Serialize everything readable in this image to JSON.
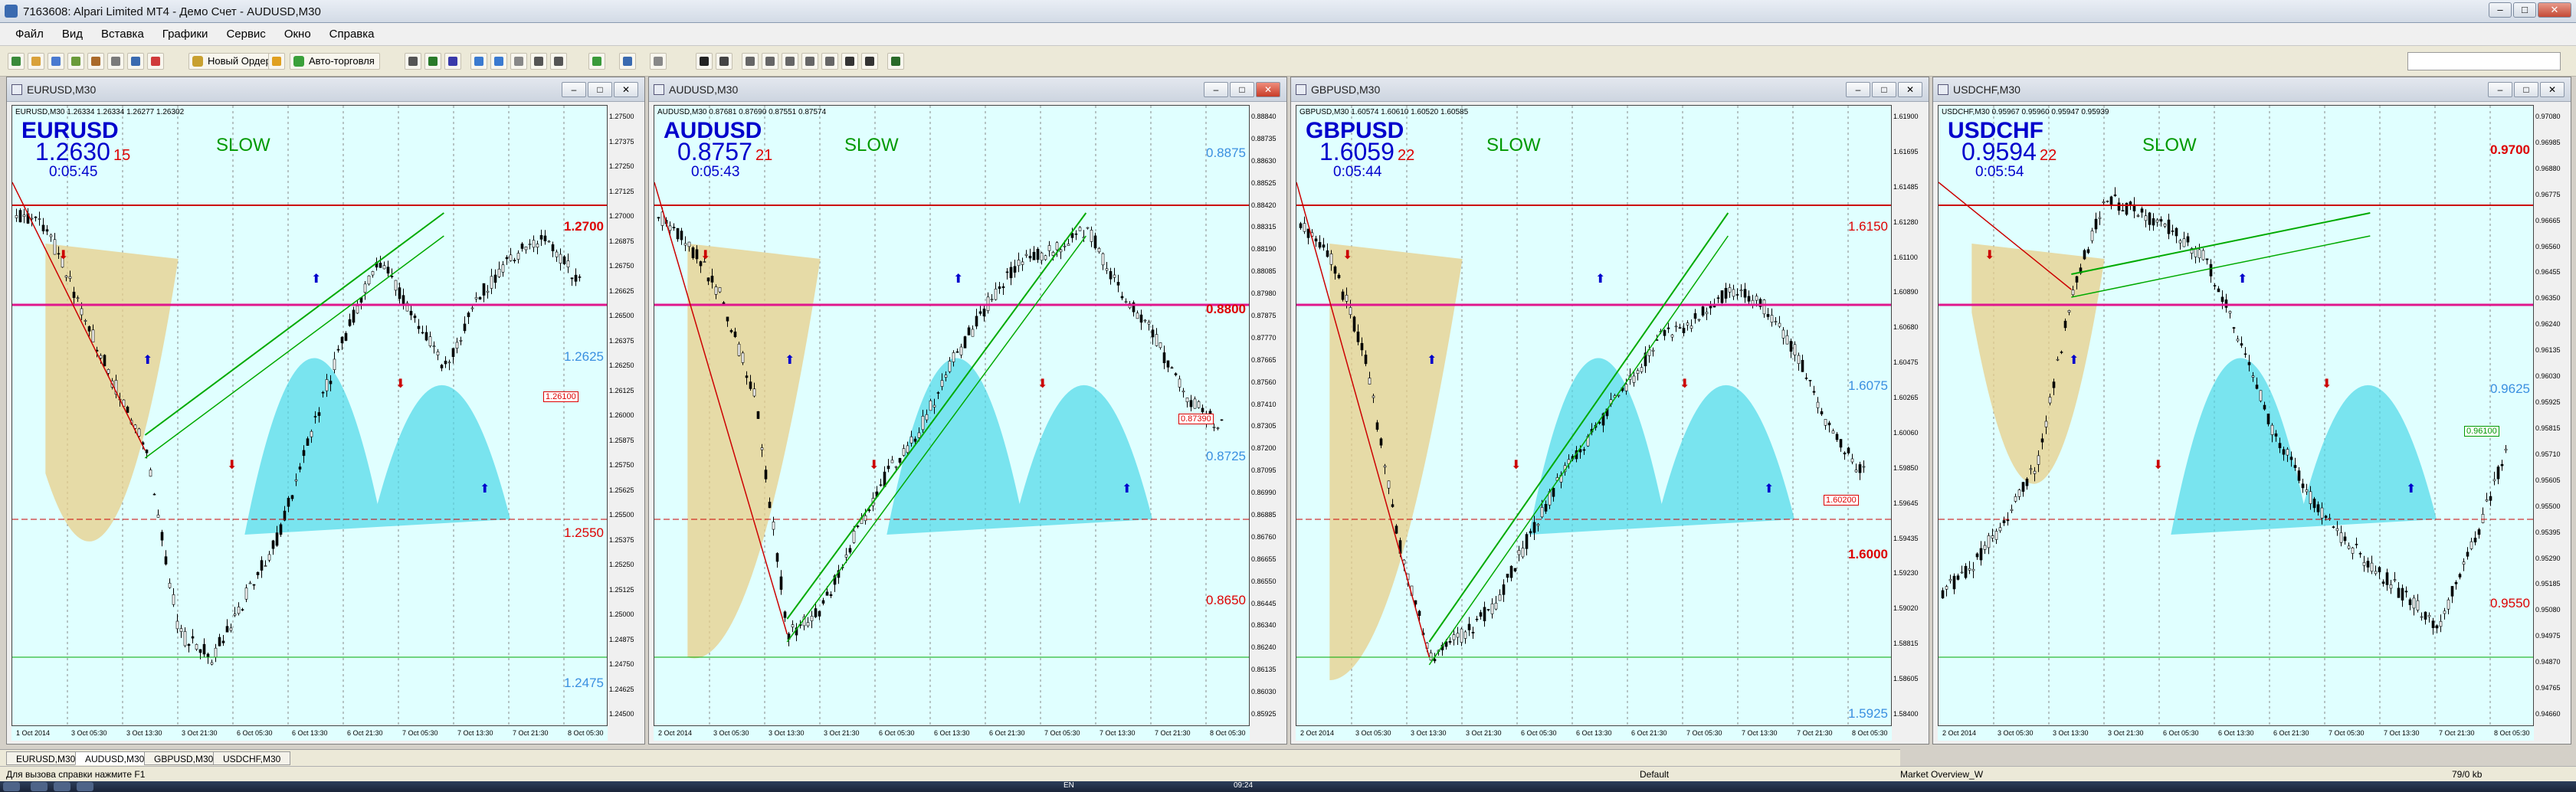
{
  "window": {
    "title": "7163608: Alpari Limited MT4 - Демо Счет - AUDUSD,M30"
  },
  "menu": [
    "Файл",
    "Вид",
    "Вставка",
    "Графики",
    "Сервис",
    "Окно",
    "Справка"
  ],
  "toolbar": {
    "new_order": "Новый Ордер",
    "autotrading": "Авто-торговля"
  },
  "colors": {
    "bg": "#E0FFFF",
    "bull": "#00AA00",
    "bear": "#CC0000",
    "cyan_fill": "#4DD9E8",
    "tan_fill": "#E8CF8A",
    "magenta": "#E0168C",
    "blue": "#0000CC",
    "green": "#009900"
  },
  "charts": [
    {
      "name": "EURUSD,M30",
      "info": "EURUSD,M30 1.26334 1.26334 1.26277 1.26302",
      "symbol": "EURUSD",
      "price": "1.2630",
      "spread": "15",
      "timer": "0:05:45",
      "mode": "SLOW",
      "yticks": [
        "1.27500",
        "1.27375",
        "1.27250",
        "1.27125",
        "1.27000",
        "1.26875",
        "1.26750",
        "1.26625",
        "1.26500",
        "1.26375",
        "1.26250",
        "1.26125",
        "1.26000",
        "1.25875",
        "1.25750",
        "1.25625",
        "1.25500",
        "1.25375",
        "1.25250",
        "1.25125",
        "1.25000",
        "1.24875",
        "1.24750",
        "1.24625",
        "1.24500"
      ],
      "xticks": [
        "1 Oct 2014",
        "3 Oct 05:30",
        "3 Oct 13:30",
        "3 Oct 21:30",
        "6 Oct 05:30",
        "6 Oct 13:30",
        "6 Oct 21:30",
        "7 Oct 05:30",
        "7 Oct 13:30",
        "7 Oct 21:30",
        "8 Oct 05:30"
      ],
      "levels": [
        "1.2700",
        "1.2625",
        "1.2550",
        "1.2475",
        "1.26100"
      ],
      "price_tags": [
        "1.27000",
        "1.26302",
        "1.26250",
        "1.25480",
        "1.25500",
        "1.24750"
      ]
    },
    {
      "name": "AUDUSD,M30",
      "info": "AUDUSD,M30 0.87681 0.87690 0.87551 0.87574",
      "symbol": "AUDUSD",
      "price": "0.8757",
      "spread": "21",
      "timer": "0:05:43",
      "mode": "SLOW",
      "yticks": [
        "0.88840",
        "0.88735",
        "0.88630",
        "0.88525",
        "0.88420",
        "0.88315",
        "0.88190",
        "0.88085",
        "0.87980",
        "0.87875",
        "0.87770",
        "0.87665",
        "0.87560",
        "0.87410",
        "0.87305",
        "0.87200",
        "0.87095",
        "0.86990",
        "0.86885",
        "0.86760",
        "0.86655",
        "0.86550",
        "0.86445",
        "0.86340",
        "0.86240",
        "0.86135",
        "0.86030",
        "0.85925"
      ],
      "xticks": [
        "2 Oct 2014",
        "3 Oct 05:30",
        "3 Oct 13:30",
        "3 Oct 21:30",
        "6 Oct 05:30",
        "6 Oct 13:30",
        "6 Oct 21:30",
        "7 Oct 05:30",
        "7 Oct 13:30",
        "7 Oct 21:30",
        "8 Oct 05:30"
      ],
      "levels": [
        "0.8875",
        "0.8800",
        "0.8725",
        "0.8650",
        "0.87390"
      ],
      "price_tags": [
        "0.88750",
        "0.88000",
        "0.87574",
        "0.87250",
        "0.86500",
        "0.86000"
      ]
    },
    {
      "name": "GBPUSD,M30",
      "info": "GBPUSD,M30 1.60574 1.60610 1.60520 1.60585",
      "symbol": "GBPUSD",
      "price": "1.6059",
      "spread": "22",
      "timer": "0:05:44",
      "mode": "SLOW",
      "yticks": [
        "1.61900",
        "1.61695",
        "1.61485",
        "1.61280",
        "1.61100",
        "1.60890",
        "1.60680",
        "1.60475",
        "1.60265",
        "1.60060",
        "1.59850",
        "1.59645",
        "1.59435",
        "1.59230",
        "1.59020",
        "1.58815",
        "1.58605",
        "1.58400"
      ],
      "xticks": [
        "2 Oct 2014",
        "3 Oct 05:30",
        "3 Oct 13:30",
        "3 Oct 21:30",
        "6 Oct 05:30",
        "6 Oct 13:30",
        "6 Oct 21:30",
        "7 Oct 05:30",
        "7 Oct 13:30",
        "7 Oct 21:30",
        "8 Oct 05:30"
      ],
      "levels": [
        "1.6150",
        "1.6075",
        "1.6000",
        "1.5925",
        "1.60200"
      ],
      "price_tags": [
        "1.60750",
        "1.60585",
        "1.60000",
        "1.59250"
      ]
    },
    {
      "name": "USDCHF,M30",
      "info": "USDCHF,M30 0.95967 0.95960 0.95947 0.95939",
      "symbol": "USDCHF",
      "price": "0.9594",
      "spread": "22",
      "timer": "0:05:54",
      "mode": "SLOW",
      "yticks": [
        "0.97080",
        "0.96985",
        "0.96880",
        "0.96775",
        "0.96665",
        "0.96560",
        "0.96455",
        "0.96350",
        "0.96240",
        "0.96135",
        "0.96030",
        "0.95925",
        "0.95815",
        "0.95710",
        "0.95605",
        "0.95500",
        "0.95395",
        "0.95290",
        "0.95185",
        "0.95080",
        "0.94975",
        "0.94870",
        "0.94765",
        "0.94660"
      ],
      "xticks": [
        "2 Oct 2014",
        "3 Oct 05:30",
        "3 Oct 13:30",
        "3 Oct 21:30",
        "6 Oct 05:30",
        "6 Oct 13:30",
        "6 Oct 21:30",
        "7 Oct 05:30",
        "7 Oct 13:30",
        "7 Oct 21:30",
        "8 Oct 05:30"
      ],
      "levels": [
        "0.9700",
        "0.9625",
        "0.9550",
        "0.96100"
      ],
      "price_tags": [
        "0.97000",
        "0.96250",
        "0.95939"
      ]
    }
  ],
  "tabs": [
    "EURUSD,M30",
    "AUDUSD,M30",
    "GBPUSD,M30",
    "USDCHF,M30"
  ],
  "status": {
    "help": "Для вызова справки нажмите F1",
    "default": "Default",
    "profile": "Market Overview_W",
    "traffic": "79/0 kb"
  },
  "taskbar": {
    "lang": "EN",
    "clock": "09:24"
  }
}
